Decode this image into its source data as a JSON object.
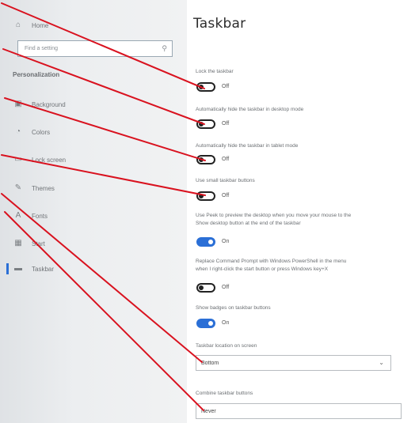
{
  "sidebar": {
    "home_label": "Home",
    "search_placeholder": "Find a setting",
    "section": "Personalization",
    "items": [
      {
        "label": "Background",
        "icon": "picture-icon"
      },
      {
        "label": "Colors",
        "icon": "palette-icon"
      },
      {
        "label": "Lock screen",
        "icon": "lock-screen-icon"
      },
      {
        "label": "Themes",
        "icon": "brush-icon"
      },
      {
        "label": "Fonts",
        "icon": "font-icon"
      },
      {
        "label": "Start",
        "icon": "start-icon"
      },
      {
        "label": "Taskbar",
        "icon": "taskbar-icon"
      }
    ]
  },
  "main": {
    "title": "Taskbar",
    "settings": [
      {
        "label": "Lock the taskbar",
        "state": "Off",
        "on": false
      },
      {
        "label": "Automatically hide the taskbar in desktop mode",
        "state": "Off",
        "on": false
      },
      {
        "label": "Automatically hide the taskbar in tablet mode",
        "state": "Off",
        "on": false
      },
      {
        "label": "Use small taskbar buttons",
        "state": "Off",
        "on": false
      },
      {
        "label": "Use Peek to preview the desktop when you move your mouse to the",
        "label2": "Show desktop button at the end of the taskbar",
        "state": "On",
        "on": true
      },
      {
        "label": "Replace Command Prompt with Windows PowerShell in the menu",
        "label2": "when I right-click the start button or press Windows key+X",
        "state": "Off",
        "on": false
      },
      {
        "label": "Show badges on taskbar buttons",
        "state": "On",
        "on": true
      }
    ],
    "location_label": "Taskbar location on screen",
    "location_value": "Bottom",
    "combine_label": "Combine taskbar buttons",
    "combine_value": "Never"
  },
  "colors": {
    "accent": "#2b6fd6",
    "callout": "#d9121f"
  }
}
